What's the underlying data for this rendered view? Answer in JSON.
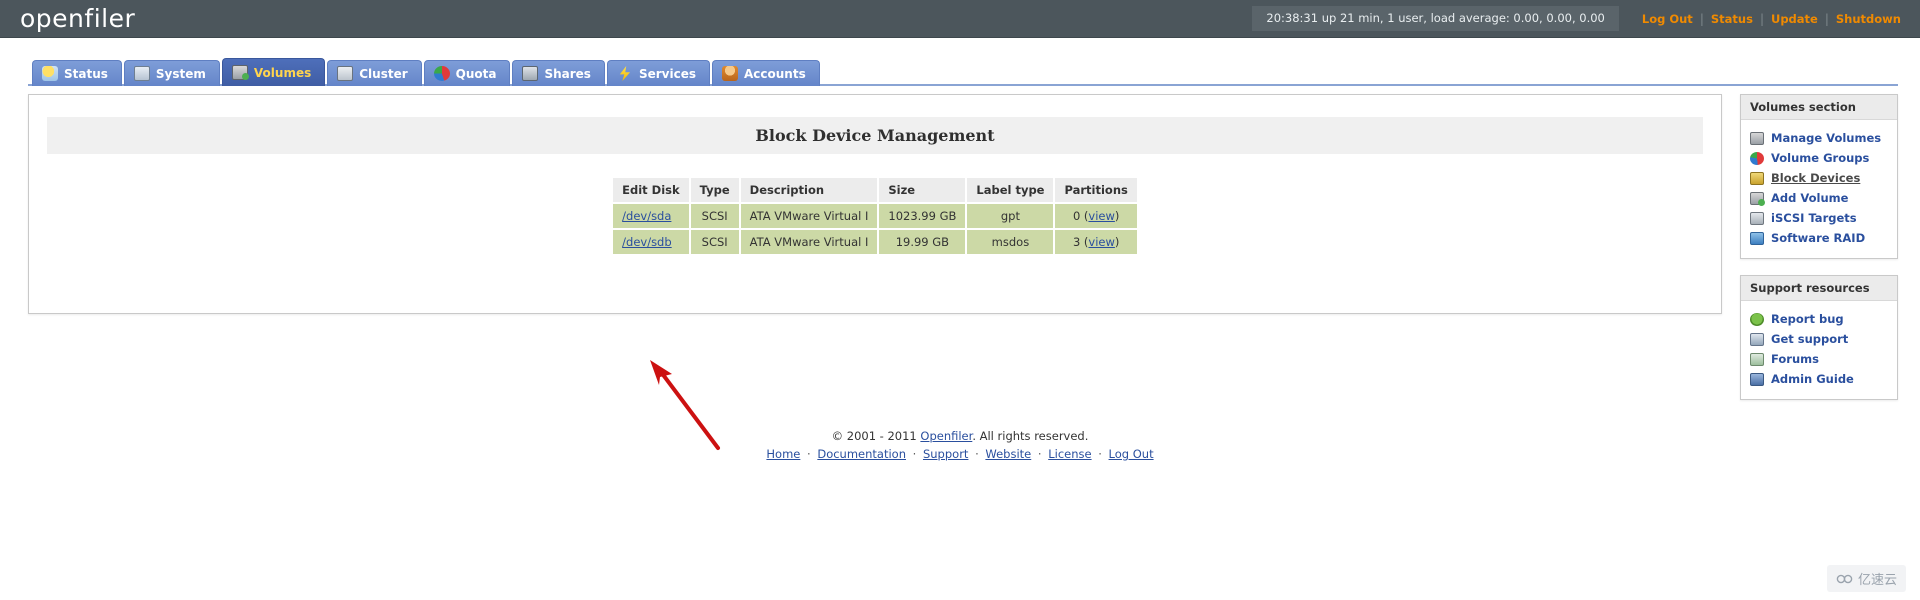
{
  "topbar": {
    "brand": "openfiler",
    "system_status": "20:38:31 up 21 min, 1 user, load average: 0.00, 0.00, 0.00",
    "links": [
      {
        "label": "Log Out",
        "icon": "logout-icon"
      },
      {
        "label": "Status",
        "icon": "status-icon"
      },
      {
        "label": "Update",
        "icon": "update-icon"
      },
      {
        "label": "Shutdown",
        "icon": "shutdown-icon"
      }
    ],
    "separator": "|",
    "link_color": "#f08a00",
    "bar_color": "#4c565c"
  },
  "tabs": [
    {
      "label": "Status",
      "icon": "status-tab-icon",
      "active": false
    },
    {
      "label": "System",
      "icon": "system-tab-icon",
      "active": false
    },
    {
      "label": "Volumes",
      "icon": "volumes-tab-icon",
      "active": true
    },
    {
      "label": "Cluster",
      "icon": "cluster-tab-icon",
      "active": false
    },
    {
      "label": "Quota",
      "icon": "quota-tab-icon",
      "active": false
    },
    {
      "label": "Shares",
      "icon": "shares-tab-icon",
      "active": false
    },
    {
      "label": "Services",
      "icon": "services-tab-icon",
      "active": false
    },
    {
      "label": "Accounts",
      "icon": "accounts-tab-icon",
      "active": false
    }
  ],
  "main": {
    "page_title": "Block Device Management",
    "table": {
      "columns": [
        "Edit Disk",
        "Type",
        "Description",
        "Size",
        "Label type",
        "Partitions"
      ],
      "rows": [
        {
          "disk": "/dev/sda",
          "type": "SCSI",
          "description": "ATA VMware Virtual I",
          "size": "1023.99 GB",
          "label_type": "gpt",
          "partition_count": "0",
          "partition_view": "view",
          "paren_open": "(",
          "paren_close": ")"
        },
        {
          "disk": "/dev/sdb",
          "type": "SCSI",
          "description": "ATA VMware Virtual I",
          "size": "19.99 GB",
          "label_type": "msdos",
          "partition_count": "3",
          "partition_view": "view",
          "paren_open": "(",
          "paren_close": ")"
        }
      ],
      "row_color": "#ccd9a6",
      "header_color": "#ececec"
    }
  },
  "sidebar": {
    "volumes_section": {
      "title": "Volumes section",
      "items": [
        {
          "label": "Manage Volumes",
          "icon": "manage-volumes-icon",
          "current": false
        },
        {
          "label": "Volume Groups",
          "icon": "volume-groups-icon",
          "current": false
        },
        {
          "label": "Block Devices",
          "icon": "block-devices-icon",
          "current": true
        },
        {
          "label": "Add Volume",
          "icon": "add-volume-icon",
          "current": false
        },
        {
          "label": "iSCSI Targets",
          "icon": "iscsi-targets-icon",
          "current": false
        },
        {
          "label": "Software RAID",
          "icon": "software-raid-icon",
          "current": false
        }
      ]
    },
    "support_section": {
      "title": "Support resources",
      "items": [
        {
          "label": "Report bug",
          "icon": "report-bug-icon",
          "current": false
        },
        {
          "label": "Get support",
          "icon": "get-support-icon",
          "current": false
        },
        {
          "label": "Forums",
          "icon": "forums-icon",
          "current": false
        },
        {
          "label": "Admin Guide",
          "icon": "admin-guide-icon",
          "current": false
        }
      ]
    }
  },
  "footer": {
    "copyright_prefix": "© 2001 - 2011 ",
    "copyright_link": "Openfiler",
    "copyright_suffix": ". All rights reserved.",
    "links": [
      "Home",
      "Documentation",
      "Support",
      "Website",
      "License",
      "Log Out"
    ],
    "separator": "·"
  },
  "annotation": {
    "arrow_color": "#cc1111",
    "points_to": "/dev/sda"
  },
  "watermark": {
    "text": "亿速云",
    "icon": "cloud-icon"
  }
}
